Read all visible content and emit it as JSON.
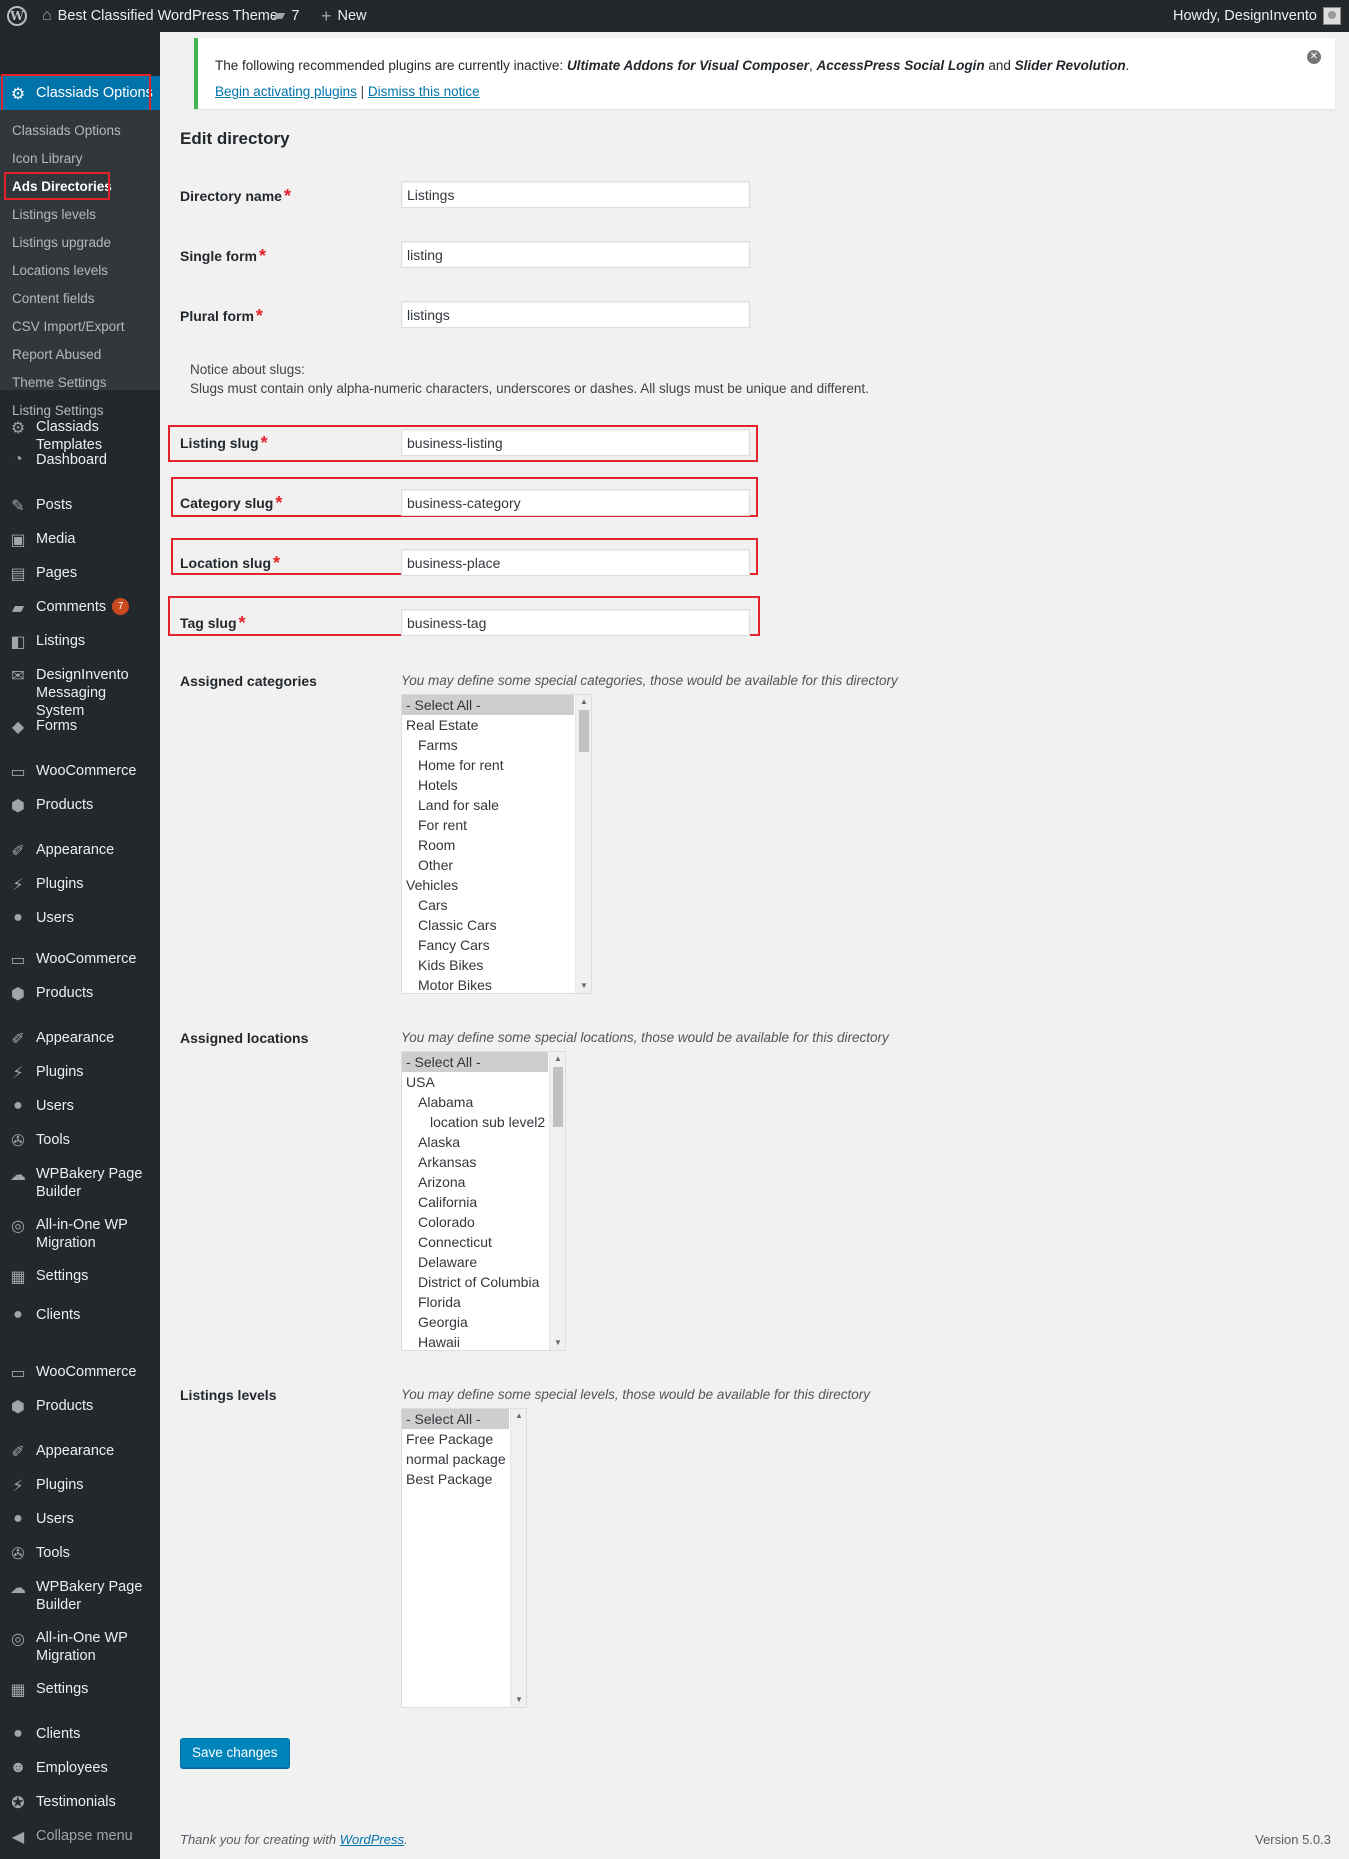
{
  "adminbar": {
    "site_name": "Best Classified WordPress Theme",
    "comments_count": "7",
    "new_label": "New",
    "howdy": "Howdy, DesignInvento"
  },
  "sidebar": {
    "active_top": "Classiads Options",
    "submenu": [
      "Classiads Options",
      "Icon Library",
      "Ads Directories",
      "Listings levels",
      "Listings upgrade",
      "Locations levels",
      "Content fields",
      "CSV Import/Export",
      "Report Abused",
      "Theme Settings",
      "Listing Settings"
    ],
    "items": [
      {
        "label": "Classiads Templates",
        "icon": "gear-icon"
      },
      {
        "label": "Dashboard",
        "icon": "dashboard-icon"
      },
      {
        "label": "Posts",
        "icon": "pin-icon"
      },
      {
        "label": "Media",
        "icon": "media-icon"
      },
      {
        "label": "Pages",
        "icon": "pages-icon"
      },
      {
        "label": "Comments",
        "icon": "comment-icon",
        "badge": "7"
      },
      {
        "label": "Listings",
        "icon": "listings-icon"
      },
      {
        "label": "DesignInvento Messaging System",
        "icon": "mail-icon"
      },
      {
        "label": "Forms",
        "icon": "forms-icon"
      },
      {
        "label": "WooCommerce",
        "icon": "woo-icon"
      },
      {
        "label": "Products",
        "icon": "box-icon"
      },
      {
        "label": "Appearance",
        "icon": "brush-icon"
      },
      {
        "label": "Plugins",
        "icon": "plug-icon"
      },
      {
        "label": "Users",
        "icon": "user-icon"
      },
      {
        "label": "WooCommerce",
        "icon": "woo-icon"
      },
      {
        "label": "Products",
        "icon": "box-icon"
      },
      {
        "label": "Appearance",
        "icon": "brush-icon"
      },
      {
        "label": "Plugins",
        "icon": "plug-icon"
      },
      {
        "label": "Users",
        "icon": "user-icon"
      },
      {
        "label": "Tools",
        "icon": "wrench-icon"
      },
      {
        "label": "WPBakery Page Builder",
        "icon": "cloud-icon"
      },
      {
        "label": "All-in-One WP Migration",
        "icon": "migration-icon"
      },
      {
        "label": "Settings",
        "icon": "settings-icon"
      },
      {
        "label": "Clients",
        "icon": "user-icon"
      },
      {
        "label": "WooCommerce",
        "icon": "woo-icon"
      },
      {
        "label": "Products",
        "icon": "box-icon"
      },
      {
        "label": "Appearance",
        "icon": "brush-icon"
      },
      {
        "label": "Plugins",
        "icon": "plug-icon"
      },
      {
        "label": "Users",
        "icon": "user-icon"
      },
      {
        "label": "Tools",
        "icon": "wrench-icon"
      },
      {
        "label": "WPBakery Page Builder",
        "icon": "cloud-icon"
      },
      {
        "label": "All-in-One WP Migration",
        "icon": "migration-icon"
      },
      {
        "label": "Settings",
        "icon": "settings-icon"
      },
      {
        "label": "Clients",
        "icon": "user-icon"
      },
      {
        "label": "Employees",
        "icon": "group-icon"
      },
      {
        "label": "Testimonials",
        "icon": "award-icon"
      },
      {
        "label": "Collapse menu",
        "icon": "collapse-icon"
      }
    ]
  },
  "notice": {
    "prefix": "The following recommended plugins are currently inactive: ",
    "plugin1": "Ultimate Addons for Visual Composer",
    "sep1": ", ",
    "plugin2": "AccessPress Social Login",
    "sep2": " and ",
    "plugin3": "Slider Revolution",
    "suffix": ".",
    "link_activate": "Begin activating plugins",
    "link_sep": " | ",
    "link_dismiss": "Dismiss this notice"
  },
  "form": {
    "title": "Edit directory",
    "directory_name": {
      "label": "Directory name",
      "value": "Listings"
    },
    "single_form": {
      "label": "Single form",
      "value": "listing"
    },
    "plural_form": {
      "label": "Plural form",
      "value": "listings"
    },
    "slug_notice_title": "Notice about slugs:",
    "slug_notice_text": "Slugs must contain only alpha-numeric characters, underscores or dashes. All slugs must be unique and different.",
    "listing_slug": {
      "label": "Listing slug",
      "value": "business-listing"
    },
    "category_slug": {
      "label": "Category slug",
      "value": "business-category"
    },
    "location_slug": {
      "label": "Location slug",
      "value": "business-place"
    },
    "tag_slug": {
      "label": "Tag slug",
      "value": "business-tag"
    },
    "categories": {
      "label": "Assigned categories",
      "desc": "You may define some special categories, those would be available for this directory",
      "options": [
        {
          "text": "- Select All -",
          "level": 0,
          "selected": true
        },
        {
          "text": "Real Estate",
          "level": 0
        },
        {
          "text": "Farms",
          "level": 1
        },
        {
          "text": "Home for rent",
          "level": 1
        },
        {
          "text": "Hotels",
          "level": 1
        },
        {
          "text": "Land for sale",
          "level": 1
        },
        {
          "text": "For rent",
          "level": 1
        },
        {
          "text": "Room",
          "level": 1
        },
        {
          "text": "Other",
          "level": 1
        },
        {
          "text": "Vehicles",
          "level": 0
        },
        {
          "text": "Cars",
          "level": 1
        },
        {
          "text": "Classic Cars",
          "level": 1
        },
        {
          "text": "Fancy Cars",
          "level": 1
        },
        {
          "text": "Kids Bikes",
          "level": 1
        },
        {
          "text": "Motor Bikes",
          "level": 1
        }
      ]
    },
    "locations": {
      "label": "Assigned locations",
      "desc": "You may define some special locations, those would be available for this directory",
      "options": [
        {
          "text": "- Select All -",
          "level": 0,
          "selected": true
        },
        {
          "text": "USA",
          "level": 0
        },
        {
          "text": "Alabama",
          "level": 1
        },
        {
          "text": "location sub level2",
          "level": 2
        },
        {
          "text": "Alaska",
          "level": 1
        },
        {
          "text": "Arkansas",
          "level": 1
        },
        {
          "text": "Arizona",
          "level": 1
        },
        {
          "text": "California",
          "level": 1
        },
        {
          "text": "Colorado",
          "level": 1
        },
        {
          "text": "Connecticut",
          "level": 1
        },
        {
          "text": "Delaware",
          "level": 1
        },
        {
          "text": "District of Columbia",
          "level": 1
        },
        {
          "text": "Florida",
          "level": 1
        },
        {
          "text": "Georgia",
          "level": 1
        },
        {
          "text": "Hawaii",
          "level": 1
        }
      ]
    },
    "levels": {
      "label": "Listings levels",
      "desc": "You may define some special levels, those would be available for this directory",
      "options": [
        {
          "text": "- Select All -",
          "level": 0,
          "selected": true
        },
        {
          "text": "Free Package",
          "level": 0
        },
        {
          "text": "normal package",
          "level": 0
        },
        {
          "text": "Best Package",
          "level": 0
        }
      ]
    },
    "save_label": "Save changes"
  },
  "footer": {
    "thanks_prefix": "Thank you for creating with ",
    "thanks_link": "WordPress",
    "thanks_suffix": ".",
    "version": "Version 5.0.3"
  },
  "colors": {
    "admin_bar": "#23282d",
    "sidebar": "#23282d",
    "submenu": "#32373c",
    "active": "#0073aa",
    "highlight_box": "#e3222a",
    "notice_border": "#46b450",
    "button": "#0085ba"
  }
}
